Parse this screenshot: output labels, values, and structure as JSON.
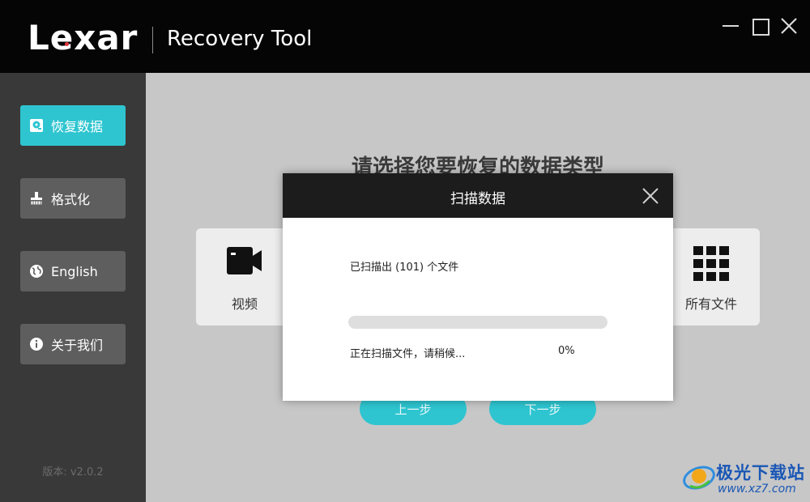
{
  "window": {
    "logo_text": "Lexar",
    "app_title": "Recovery Tool",
    "controls": [
      "minimize-icon",
      "maximize-icon",
      "close-icon"
    ]
  },
  "sidebar": {
    "items": [
      {
        "label": "恢复数据",
        "icon": "disk-recover-icon",
        "active": true
      },
      {
        "label": "格式化",
        "icon": "brush-icon",
        "active": false
      },
      {
        "label": "English",
        "icon": "globe-icon",
        "active": false
      },
      {
        "label": "关于我们",
        "icon": "info-icon",
        "active": false
      }
    ],
    "version": "版本: v2.0.2"
  },
  "main": {
    "heading": "请选择您要恢复的数据类型",
    "cards": [
      {
        "label": "视频",
        "icon": "video-camera-icon"
      },
      {
        "label": "所有文件",
        "icon": "grid-icon"
      }
    ],
    "prev_label": "上一步",
    "next_label": "下一步"
  },
  "modal": {
    "title": "扫描数据",
    "scanned_text": "已扫描出 (101) 个文件",
    "status_text": "正在扫描文件，请稍候...",
    "percent_text": "0%",
    "progress": 0
  },
  "watermark": {
    "name": "极光下载站",
    "url": "www.xz7.com"
  },
  "colors": {
    "accent": "#2ec5d0",
    "titlebar": "#050505",
    "sidebar": "#393939",
    "logo_dot": "#e3343b"
  }
}
